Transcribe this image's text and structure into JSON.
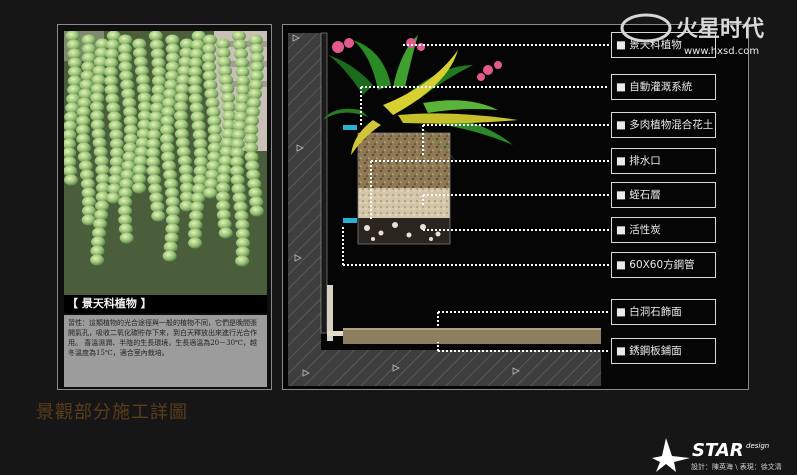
{
  "title": "景觀部分施工詳圖",
  "plant": {
    "heading": "【 景天科植物 】",
    "description": "習性：這類植物的光合途徑與一般的植物不同，它們是晚間張開氣孔，吸收二氧化碳貯存下來，到白天釋放出來進行光合作用。 喜溫濕潤、半陰的生長環境，生長適溫為20－30℃，越冬溫度為15℃，適合室內栽培。"
  },
  "labels": [
    "■ 景天科植物",
    "■ 自動灌溉系統",
    "■ 多肉植物混合花土",
    "■ 排水口",
    "■ 蛭石層",
    "■ 活性炭",
    "■ 60X60方鋼管",
    "■ 白洞石飾面",
    "■ 銹鋼板鋪面"
  ],
  "watermark": {
    "brand": "火星时代",
    "url": "www.hxsd.com"
  },
  "credits": {
    "logo_text": "STAR",
    "logo_sub": "design",
    "line": "設計：陳英海 \\ 表現：徐文清"
  },
  "colors": {
    "background": "#161616",
    "panel_border": "#8a8a8a",
    "title": "#5b3d1c",
    "leader_line": "#ffffff",
    "soil": "#8f7a55",
    "accent_pipe": "#2ab0d0"
  }
}
